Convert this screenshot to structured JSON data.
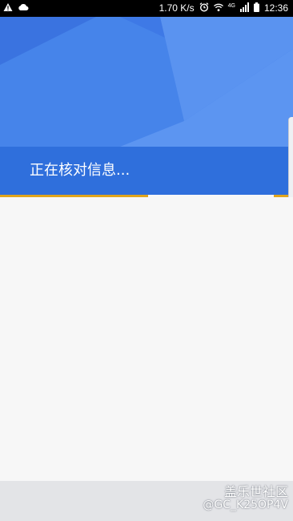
{
  "status_bar": {
    "left_icons": [
      "warning-icon",
      "cloud-icon"
    ],
    "speed": "1.70 K/s",
    "network_label": "4G",
    "time": "12:36",
    "right_icons": [
      "alarm-icon",
      "wifi-icon",
      "signal-icon",
      "battery-icon"
    ]
  },
  "page": {
    "title": "正在核对信息...",
    "loading_progress_segments": [
      {
        "from": 0.0,
        "to": 0.505
      },
      {
        "from": 0.935,
        "to": 1.0
      }
    ]
  },
  "watermark": {
    "title": "盖乐世社区",
    "user": "@GC_K25OP4V"
  },
  "colors": {
    "header_blue": "#3f7ae6",
    "title_bar_blue": "#2f6fdc",
    "progress_accent": "#e0a51d",
    "background": "#f7f7f7",
    "bottom_bar": "#e3e4e7"
  }
}
